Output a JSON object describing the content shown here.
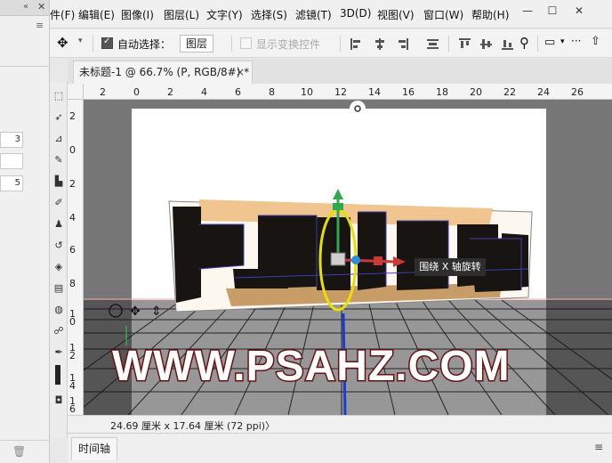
{
  "menubar": {
    "partial": "件(F)",
    "items": [
      "编辑(E)",
      "图像(I)",
      "图层(L)",
      "文字(Y)",
      "选择(S)",
      "滤镜(T)",
      "3D(D)",
      "视图(V)",
      "窗口(W)",
      "帮助(H)"
    ],
    "window_controls": [
      "—",
      "☐",
      "✕"
    ]
  },
  "options": {
    "auto_select_label": "自动选择：",
    "layer_select": "图层",
    "show_transform_label": "显示变换控件",
    "more": "···"
  },
  "doc_tab": {
    "title": "未标题-1 @ 66.7% (P, RGB/8#) *",
    "close": "×"
  },
  "left_panel": {
    "field1": "3",
    "field2": "",
    "field3": "5"
  },
  "rulers": {
    "h_labels": [
      "2",
      "0",
      "2",
      "4",
      "6",
      "8",
      "10",
      "12",
      "14",
      "16",
      "18",
      "20",
      "22",
      "24",
      "26"
    ],
    "v_labels": [
      "2",
      "0",
      "2",
      "4",
      "6",
      "8",
      "1\n0",
      "1\n2",
      "1\n4",
      "1\n6"
    ]
  },
  "tooltip": "围绕 X 轴旋转",
  "watermark": "WWW.PSAHZ.COM",
  "status": {
    "dimensions": "24.69 厘米 x 17.64 厘米 (72 ppi)",
    "arrow": "〉"
  },
  "timeline": {
    "tab": "时间轴"
  },
  "colors": {
    "accent_red": "#6b1010",
    "gizmo_green": "#2fa84f",
    "gizmo_blue": "#1a3cd6",
    "gizmo_red": "#c83a3a",
    "gizmo_yellow": "#e8e000"
  }
}
